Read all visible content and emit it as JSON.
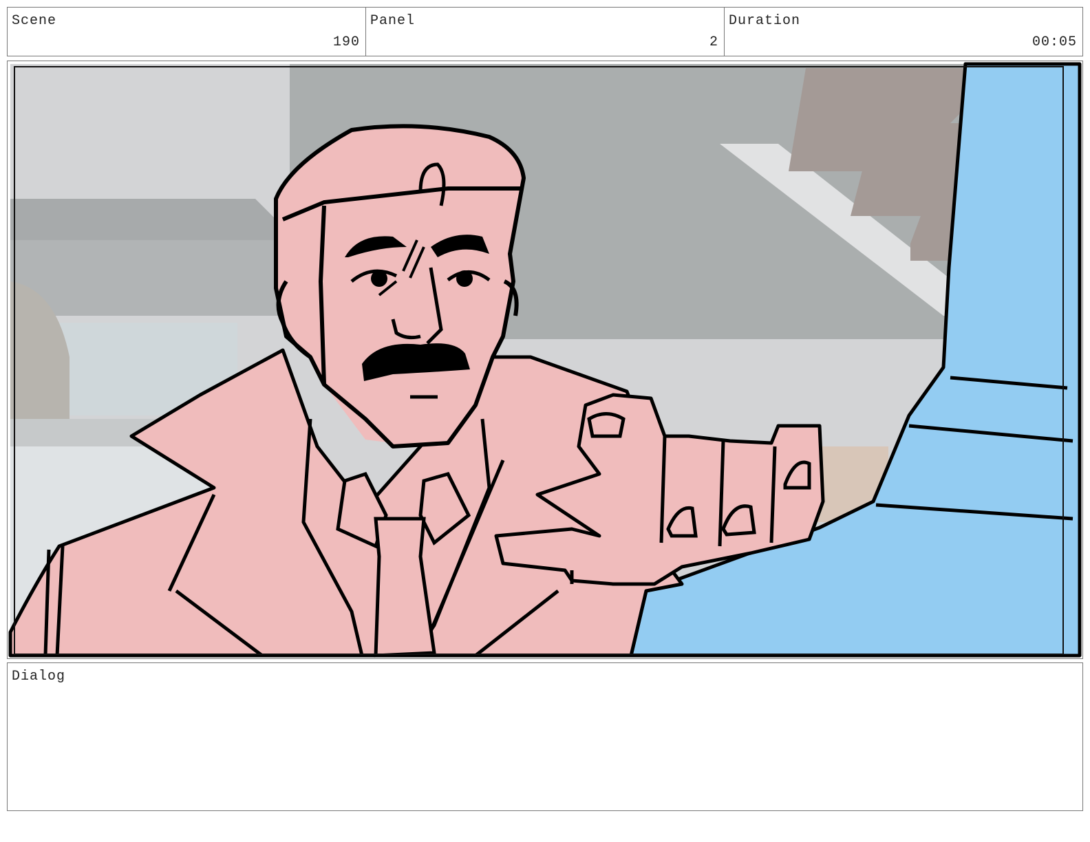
{
  "header": {
    "scene": {
      "label": "Scene",
      "value": "190"
    },
    "panel": {
      "label": "Panel",
      "value": "2"
    },
    "duration": {
      "label": "Duration",
      "value": "00:05"
    }
  },
  "panel_image": {
    "icon": "storyboard-drawing",
    "colors": {
      "skin": "#f0bcbc",
      "shirt": "#93ccf2",
      "wall_light": "#d3d4d6",
      "ceiling_dark": "#aaaeae",
      "stairs": "#a49a96",
      "line": "#000000"
    }
  },
  "dialog": {
    "label": "Dialog",
    "text": ""
  }
}
